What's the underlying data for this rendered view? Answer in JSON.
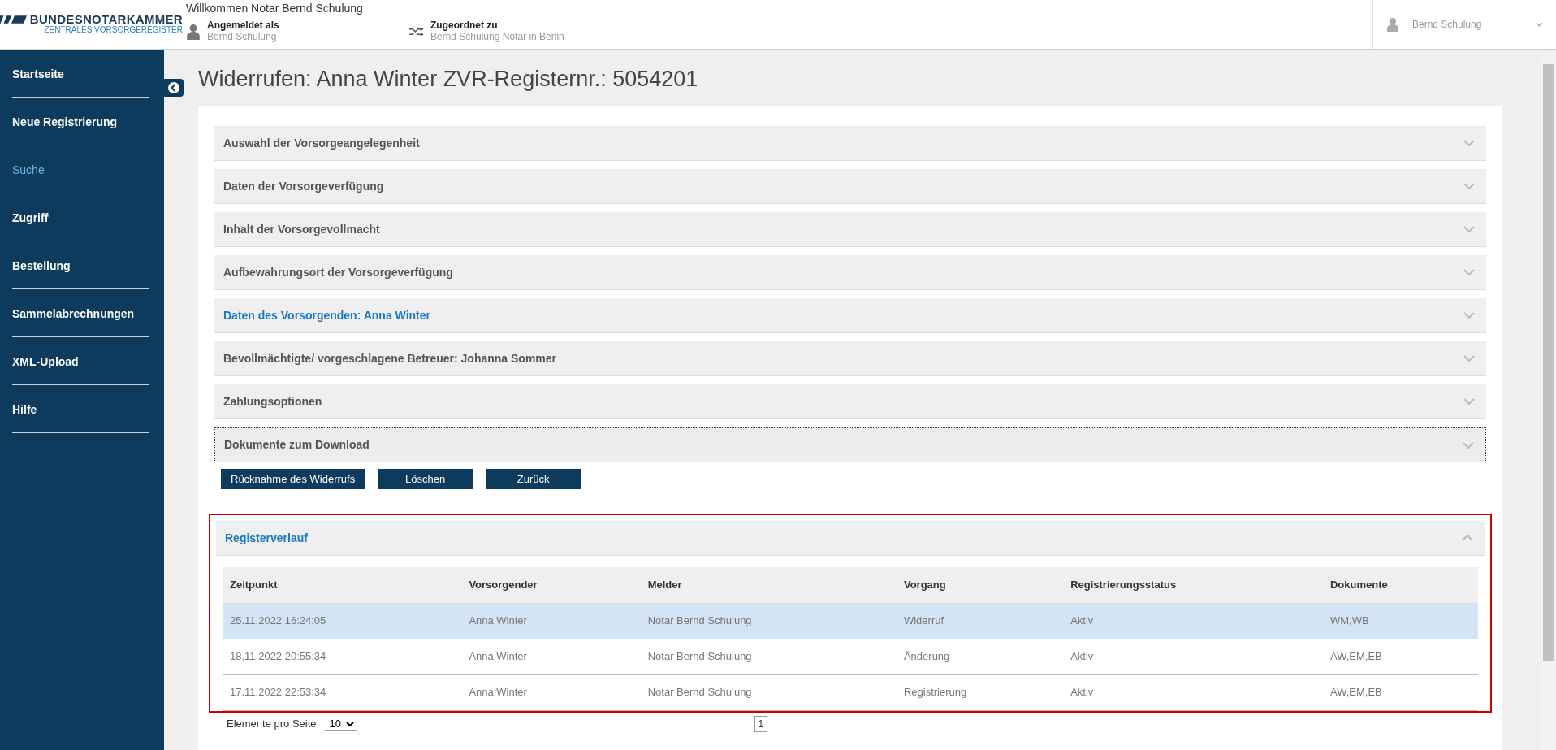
{
  "header": {
    "logo_title": "BUNDESNOTARKAMMER",
    "logo_subtitle": "ZENTRALES VORSORGEREGISTER",
    "welcome": "Willkommen Notar Bernd Schulung",
    "logged_in": {
      "label": "Angemeldet als",
      "value": "Bernd Schulung"
    },
    "assigned": {
      "label": "Zugeordnet zu",
      "value": "Bernd Schulung Notar in Berlin"
    },
    "user_menu": {
      "label": "Bernd Schulung"
    }
  },
  "sidebar": {
    "items": [
      {
        "label": "Startseite",
        "selected": false
      },
      {
        "label": "Neue Registrierung",
        "selected": false
      },
      {
        "label": "Suche",
        "selected": true
      },
      {
        "label": "Zugriff",
        "selected": false
      },
      {
        "label": "Bestellung",
        "selected": false
      },
      {
        "label": "Sammelabrechnungen",
        "selected": false
      },
      {
        "label": "XML-Upload",
        "selected": false
      },
      {
        "label": "Hilfe",
        "selected": false
      }
    ]
  },
  "page_title": "Widerrufen: Anna Winter ZVR-Registernr.: 5054201",
  "sections": [
    {
      "label": "Auswahl der Vorsorgeangelegenheit",
      "active": false,
      "focused": false
    },
    {
      "label": "Daten der Vorsorgeverfügung",
      "active": false,
      "focused": false
    },
    {
      "label": "Inhalt der Vorsorgevollmacht",
      "active": false,
      "focused": false
    },
    {
      "label": "Aufbewahrungsort der Vorsorgeverfügung",
      "active": false,
      "focused": false
    },
    {
      "label": "Daten des Vorsorgenden: Anna Winter",
      "active": true,
      "focused": false
    },
    {
      "label": "Bevollmächtigte/ vorgeschlagene Betreuer: Johanna Sommer",
      "active": false,
      "focused": false
    },
    {
      "label": "Zahlungsoptionen",
      "active": false,
      "focused": false
    },
    {
      "label": "Dokumente zum Download",
      "active": false,
      "focused": true
    }
  ],
  "buttons": [
    "Rücknahme des Widerrufs",
    "Löschen",
    "Zurück"
  ],
  "history": {
    "title": "Registerverlauf",
    "expanded": true,
    "table": {
      "columns": [
        "Zeitpunkt",
        "Vorsorgender",
        "Melder",
        "Vorgang",
        "Registrierungsstatus",
        "Dokumente"
      ],
      "rows": [
        {
          "cells": [
            "25.11.2022 16:24:05",
            "Anna Winter",
            "Notar Bernd Schulung",
            "Widerruf",
            "Aktiv",
            "WM,WB"
          ],
          "selected": true
        },
        {
          "cells": [
            "18.11.2022 20:55:34",
            "Anna Winter",
            "Notar Bernd Schulung",
            "Änderung",
            "Aktiv",
            "AW,EM,EB"
          ],
          "selected": false
        },
        {
          "cells": [
            "17.11.2022 22:53:34",
            "Anna Winter",
            "Notar Bernd Schulung",
            "Registrierung",
            "Aktiv",
            "AW,EM,EB"
          ],
          "selected": false
        }
      ]
    }
  },
  "pager": {
    "page_size_label": "Elemente pro Seite",
    "page_size": "10",
    "pages": [
      {
        "label": "1",
        "selected": true
      }
    ]
  }
}
